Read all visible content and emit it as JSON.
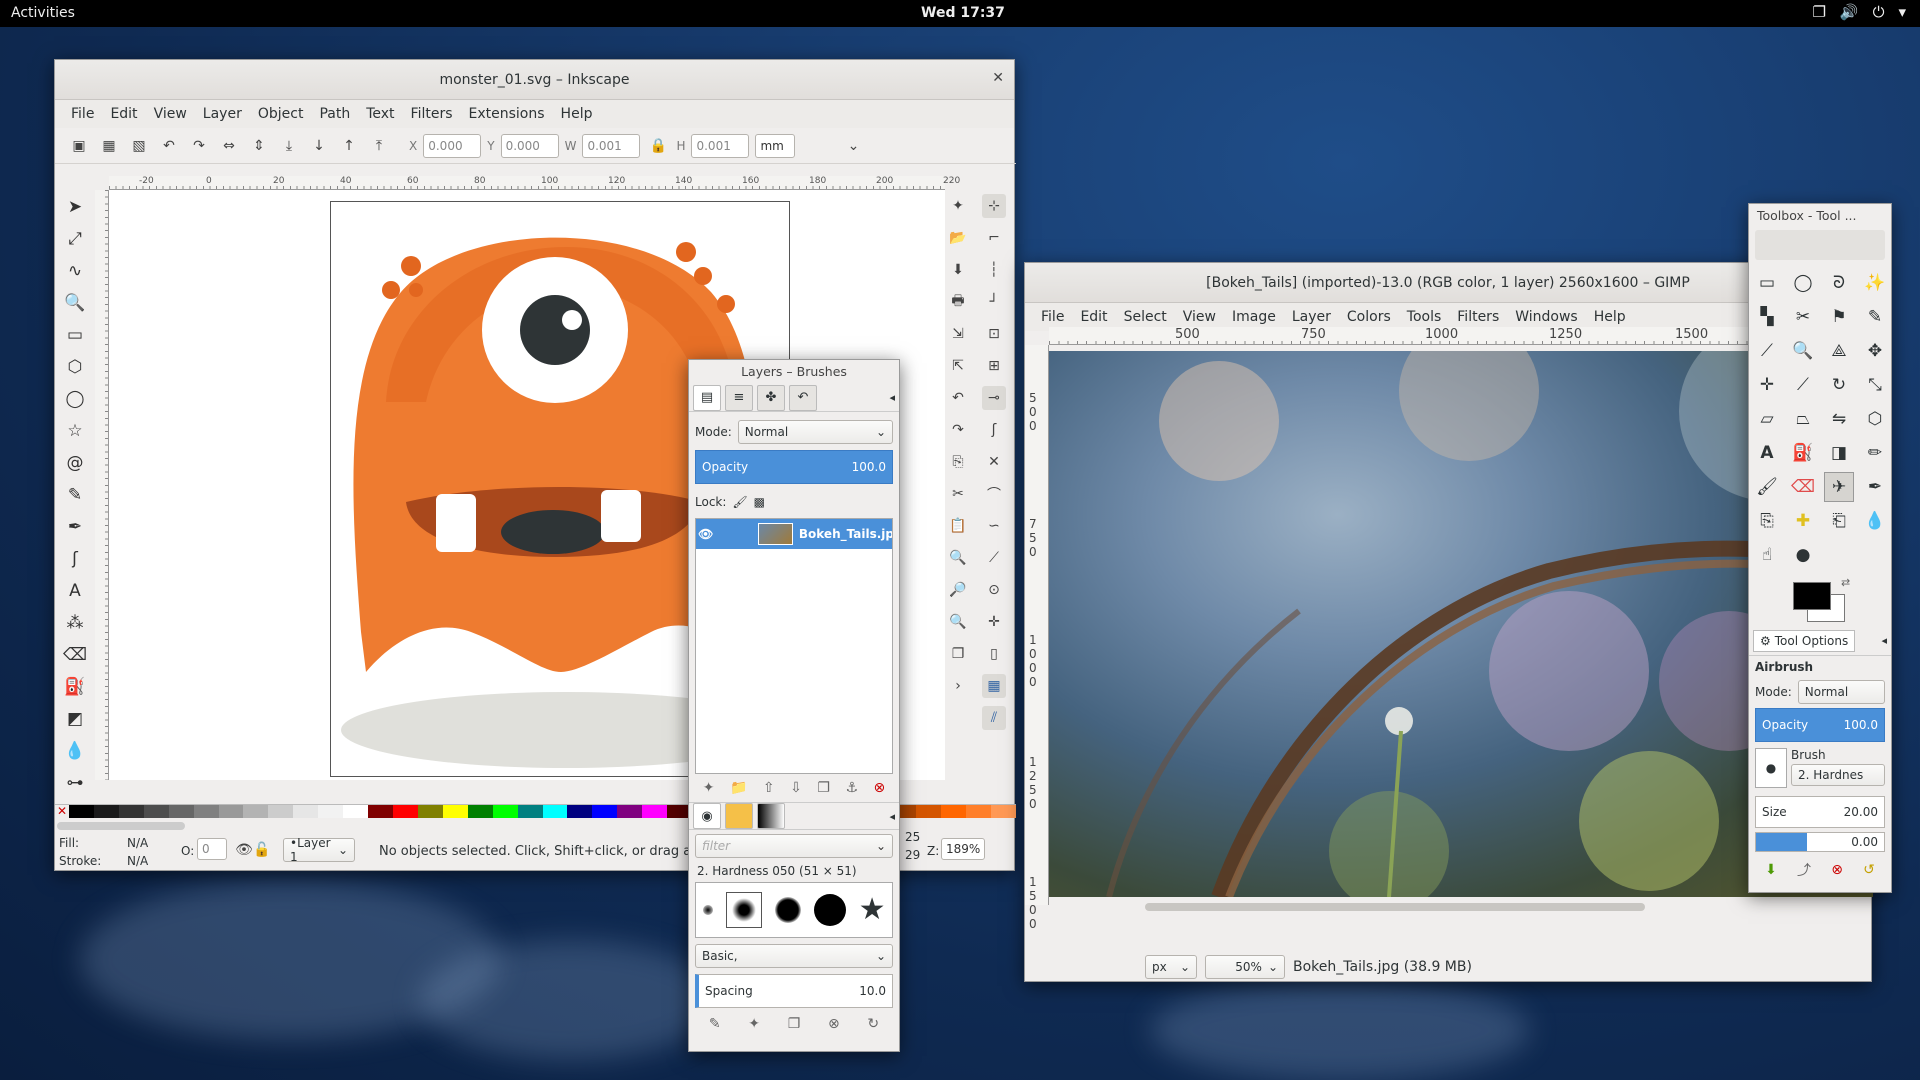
{
  "topbar": {
    "activities": "Activities",
    "clock": "Wed 17:37"
  },
  "inkscape": {
    "title": "monster_01.svg – Inkscape",
    "menu": [
      "File",
      "Edit",
      "View",
      "Layer",
      "Object",
      "Path",
      "Text",
      "Filters",
      "Extensions",
      "Help"
    ],
    "toolbar": {
      "x_label": "X",
      "x_value": "0.000",
      "y_label": "Y",
      "y_value": "0.000",
      "w_label": "W",
      "w_value": "0.001",
      "h_label": "H",
      "h_value": "0.001",
      "unit": "mm"
    },
    "ruler_ticks": [
      "-20",
      "0",
      "20",
      "40",
      "60",
      "80",
      "100",
      "120",
      "140",
      "160",
      "180",
      "200",
      "220"
    ],
    "status": {
      "fill_label": "Fill:",
      "fill_value": "N/A",
      "stroke_label": "Stroke:",
      "stroke_value": "N/A",
      "opacity_label": "O:",
      "opacity_value": "0",
      "layer": "•Layer 1",
      "message": "No objects selected. Click, Shift+click, or drag a",
      "coords_x": "25",
      "coords_y": "29",
      "zoom_label": "Z:",
      "zoom_value": "189%"
    },
    "palette": [
      "#000000",
      "#1a1a1a",
      "#333333",
      "#4d4d4d",
      "#666666",
      "#808080",
      "#999999",
      "#b3b3b3",
      "#cccccc",
      "#e6e6e6",
      "#f2f2f2",
      "#ffffff",
      "#800000",
      "#ff0000",
      "#808000",
      "#ffff00",
      "#008000",
      "#00ff00",
      "#008080",
      "#00ffff",
      "#000080",
      "#0000ff",
      "#800080",
      "#ff00ff",
      "#550000",
      "#aa0000",
      "#d40000",
      "#ff2a2a",
      "#ff5555",
      "#ff8080",
      "#ffaaaa",
      "#ffd5d5",
      "#552200",
      "#aa4400",
      "#d45500",
      "#ff6600",
      "#ff7f2a",
      "#ff9955"
    ]
  },
  "layers_dock": {
    "title": "Layers – Brushes",
    "mode_label": "Mode:",
    "mode_value": "Normal",
    "opacity_label": "Opacity",
    "opacity_value": "100.0",
    "lock_label": "Lock:",
    "layer_name": "Bokeh_Tails.jp",
    "brush_filter_placeholder": "filter",
    "brush_name": "2. Hardness 050 (51 × 51)",
    "brush_preset": "Basic,",
    "spacing_label": "Spacing",
    "spacing_value": "10.0"
  },
  "gimp": {
    "title": "[Bokeh_Tails] (imported)-13.0 (RGB color, 1 layer) 2560x1600 – GIMP",
    "menu": [
      "File",
      "Edit",
      "Select",
      "View",
      "Image",
      "Layer",
      "Colors",
      "Tools",
      "Filters",
      "Windows",
      "Help"
    ],
    "ruler_ticks": [
      "500",
      "750",
      "1000",
      "1250",
      "1500"
    ],
    "vruler_ticks": [
      "500",
      "750",
      "1000",
      "1250",
      "1500"
    ],
    "status": {
      "unit": "px",
      "zoom": "50%",
      "file": "Bokeh_Tails.jpg (38.9 MB)"
    }
  },
  "toolbox": {
    "title": "Toolbox - Tool ...",
    "tab": "Tool Options",
    "tool_name": "Airbrush",
    "mode_label": "Mode:",
    "mode_value": "Normal",
    "opacity_label": "Opacity",
    "opacity_value": "100.0",
    "brush_label": "Brush",
    "brush_value": "2. Hardnes",
    "size_label": "Size",
    "size_value": "20.00",
    "aspect_value": "0.00"
  },
  "colors": {
    "accent": "#4a90d9",
    "monster": "#ee7b30"
  }
}
